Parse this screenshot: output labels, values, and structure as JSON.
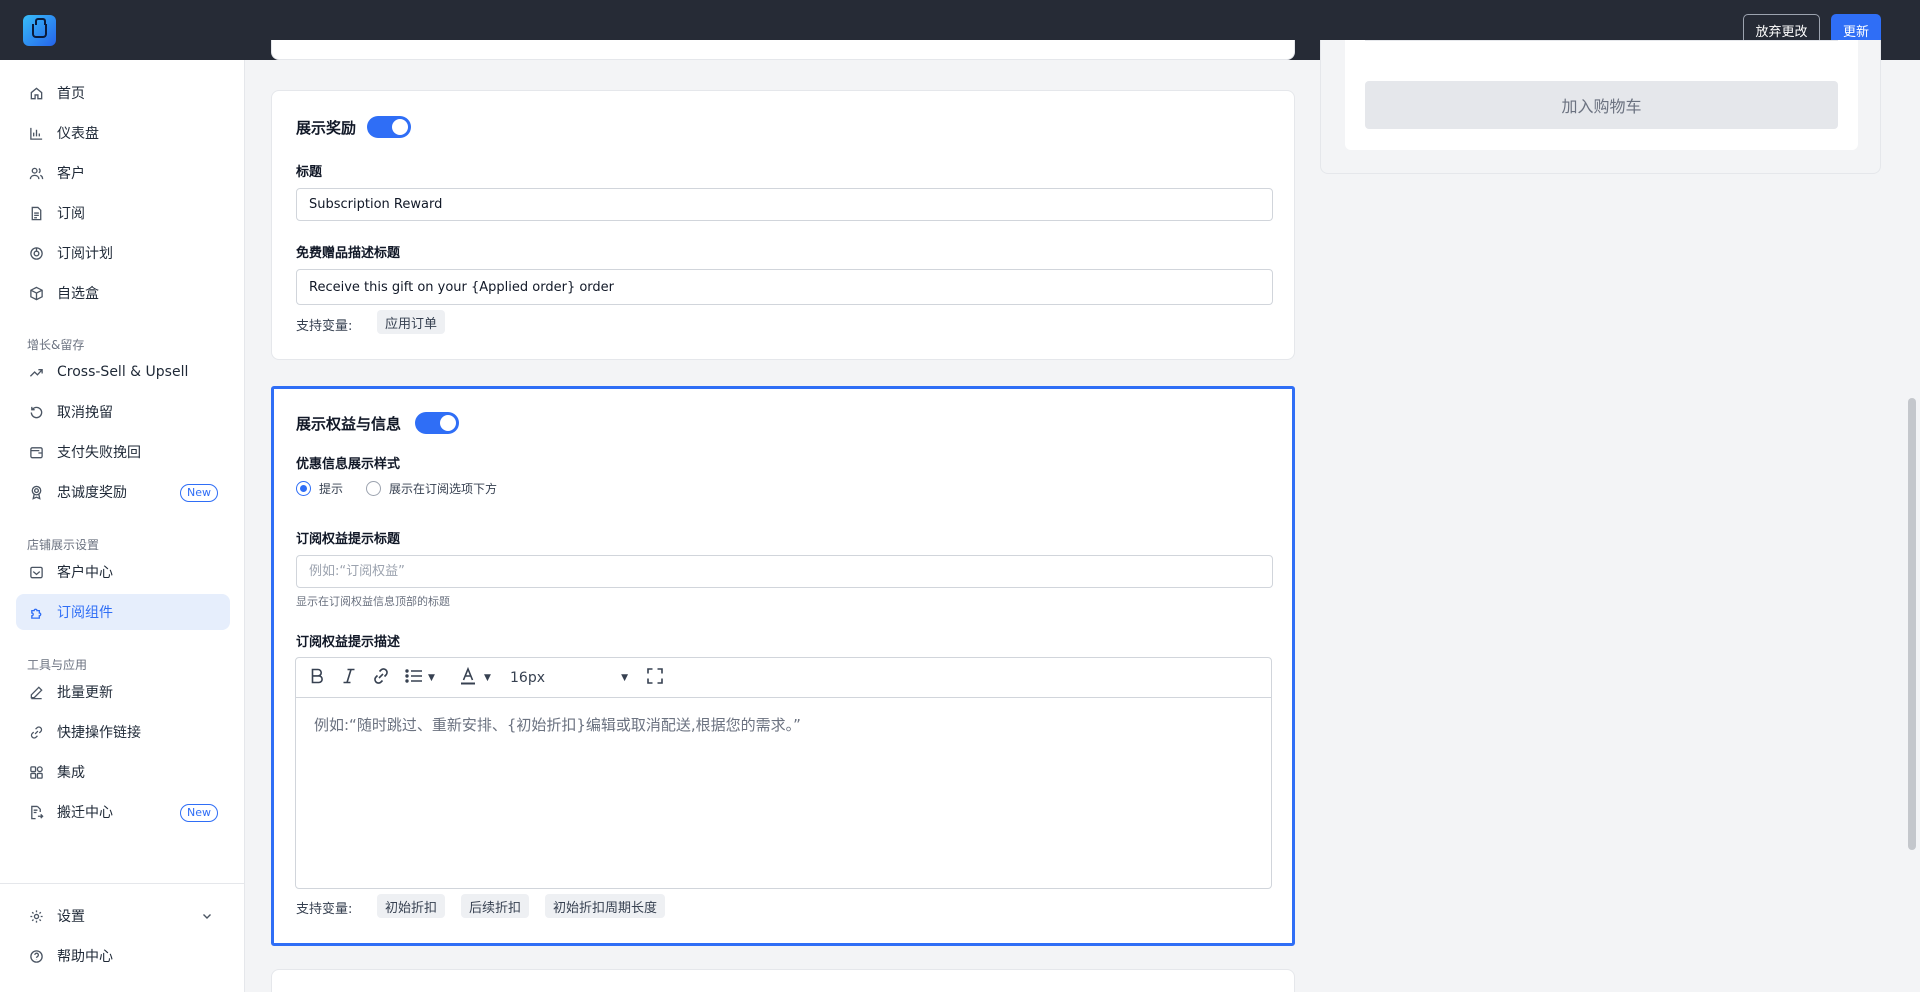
{
  "topbar": {
    "discard_label": "放弃更改",
    "update_label": "更新"
  },
  "sidebar": {
    "items": [
      {
        "label": "首页",
        "icon": "home-icon"
      },
      {
        "label": "仪表盘",
        "icon": "bar-chart-icon"
      },
      {
        "label": "客户",
        "icon": "users-icon"
      },
      {
        "label": "订阅",
        "icon": "document-icon"
      },
      {
        "label": "订阅计划",
        "icon": "plan-icon"
      },
      {
        "label": "自选盒",
        "icon": "box-icon"
      }
    ],
    "section_growth": "增长&留存",
    "growth_items": [
      {
        "label": "Cross-Sell & Upsell",
        "icon": "trending-up-icon"
      },
      {
        "label": "取消挽留",
        "icon": "rotate-icon"
      },
      {
        "label": "支付失败挽回",
        "icon": "wallet-icon"
      },
      {
        "label": "忠诚度奖励",
        "icon": "award-icon",
        "badge": "New"
      }
    ],
    "section_store": "店铺展示设置",
    "store_items": [
      {
        "label": "客户中心",
        "icon": "inbox-icon"
      },
      {
        "label": "订阅组件",
        "icon": "puzzle-icon",
        "active": true
      }
    ],
    "section_tools": "工具与应用",
    "tool_items": [
      {
        "label": "批量更新",
        "icon": "edit-icon"
      },
      {
        "label": "快捷操作链接",
        "icon": "link-icon"
      },
      {
        "label": "集成",
        "icon": "grid-icon"
      },
      {
        "label": "搬迁中心",
        "icon": "migrate-icon",
        "badge": "New"
      }
    ],
    "bottom_items": [
      {
        "label": "设置",
        "icon": "gear-icon"
      },
      {
        "label": "帮助中心",
        "icon": "help-icon"
      }
    ]
  },
  "reward_card": {
    "title": "展示奖励",
    "toggle_on": true,
    "title_label": "标题",
    "title_value": "Subscription Reward",
    "gift_label": "免费赠品描述标题",
    "gift_value": "Receive this gift on your {Applied order} order",
    "vars_label": "支持变量:",
    "vars": [
      "应用订单"
    ]
  },
  "benefits_card": {
    "title": "展示权益与信息",
    "toggle_on": true,
    "style_label": "优惠信息展示样式",
    "style_options": [
      "提示",
      "展示在订阅选项下方"
    ],
    "style_selected": 0,
    "tip_title_label": "订阅权益提示标题",
    "tip_title_placeholder": "例如:“订阅权益”",
    "tip_title_hint": "显示在订阅权益信息顶部的标题",
    "desc_label": "订阅权益提示描述",
    "font_size": "16px",
    "desc_placeholder": "例如:“随时跳过、重新安排、{初始折扣}编辑或取消配送,根据您的需求。”",
    "vars_label": "支持变量:",
    "vars": [
      "初始折扣",
      "后续折扣",
      "初始折扣周期长度"
    ]
  },
  "preview": {
    "add_to_cart": "加入购物车"
  },
  "colors": {
    "accent": "#2f6ef6",
    "topbar": "#262b36"
  }
}
